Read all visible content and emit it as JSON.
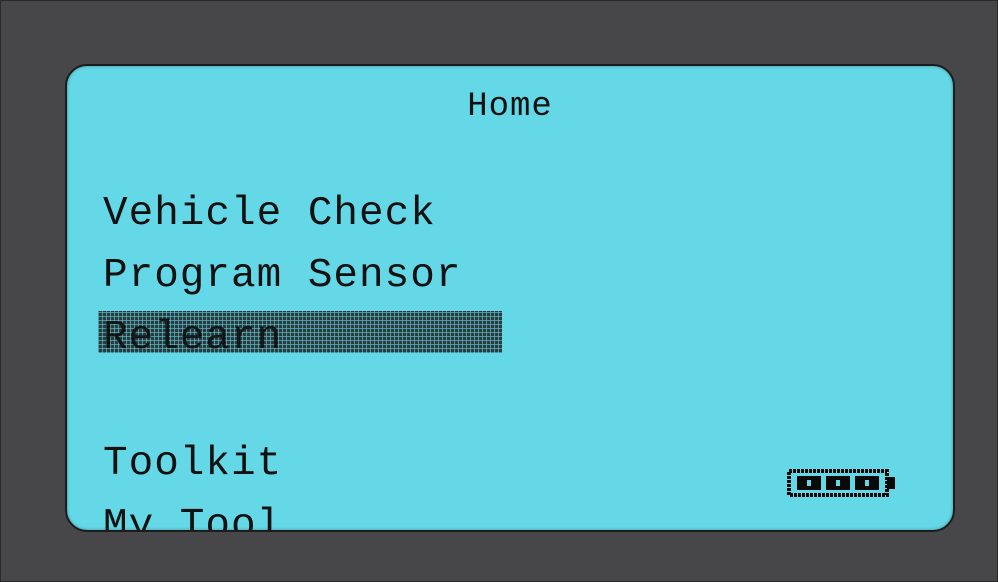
{
  "screen": {
    "title": "Home",
    "menu": [
      {
        "label": "Vehicle Check"
      },
      {
        "label": "Program Sensor"
      },
      {
        "label": "Relearn",
        "selected": true
      },
      {
        "label": ""
      },
      {
        "label": "Toolkit"
      },
      {
        "label": "My Tool"
      }
    ],
    "battery": {
      "icon": "battery-icon",
      "level_bars": 3,
      "max_bars": 3
    }
  },
  "colors": {
    "lcd_background": "#64d8e6",
    "frame": "#47474a",
    "text": "#111111",
    "selection": "#2b3c40"
  }
}
